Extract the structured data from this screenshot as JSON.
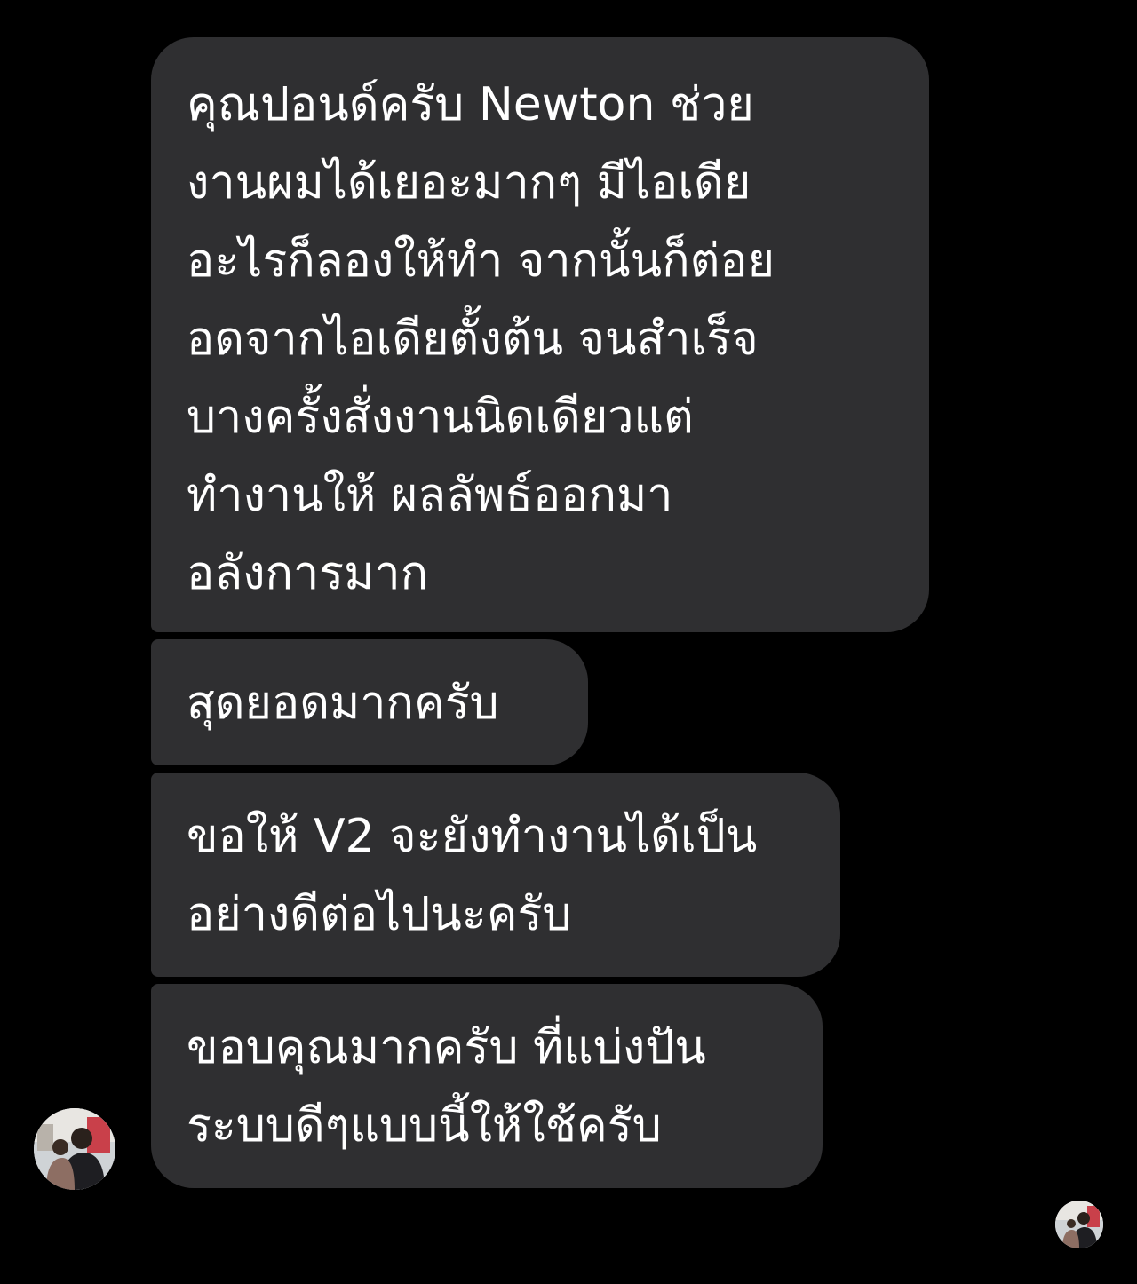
{
  "messages": [
    {
      "lines": [
        "คุณปอนด์ครับ Newton ช่วย",
        "งานผมได้เยอะมากๆ มีไอเดีย",
        "อะไรก็ลองให้ทำ จากนั้นก็ต่อย",
        "อดจากไอเดียตั้งต้น จนสำเร็จ",
        "บางครั้งสั่งงานนิดเดียวแต่",
        "ทำงานให้ ผลลัพธ์ออกมา",
        "อลังการมาก"
      ]
    },
    {
      "lines": [
        "สุดยอดมากครับ"
      ]
    },
    {
      "lines": [
        "ขอให้ V2 จะยังทำงานได้เป็น",
        "อย่างดีต่อไปนะครับ"
      ]
    },
    {
      "lines": [
        "ขอบคุณมากครับ ที่แบ่งปัน",
        "ระบบดีๆแบบนี้ให้ใช้ครับ"
      ]
    }
  ],
  "colors": {
    "background": "#000000",
    "bubble": "#2f2f31",
    "text": "#ffffff"
  },
  "icons": {
    "sender_avatar": "avatar-photo",
    "seen_receipt": "seen-avatar-photo"
  }
}
